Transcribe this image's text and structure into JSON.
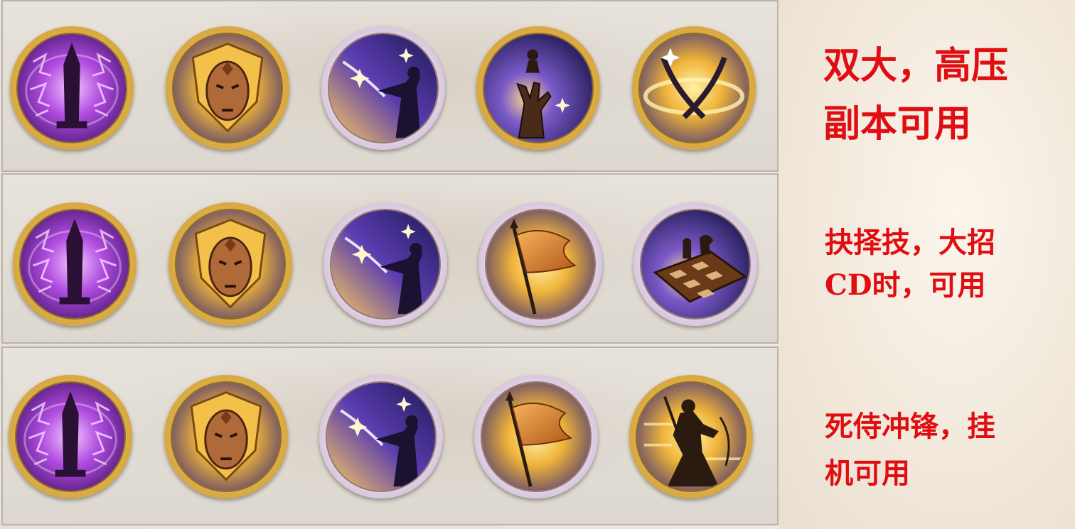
{
  "colors": {
    "note_red": "#e00d12",
    "frame_gold": "#d8a840",
    "frame_silver": "#e9d8ea",
    "panel_bg": "#e2ddd5"
  },
  "rows": [
    {
      "skills": [
        {
          "icon": "purple-obelisk-icon",
          "frame": "gold"
        },
        {
          "icon": "golden-mask-shield-icon",
          "frame": "gold"
        },
        {
          "icon": "sword-silhouette-icon",
          "frame": "silver"
        },
        {
          "icon": "chess-pawn-hand-icon",
          "frame": "gold"
        },
        {
          "icon": "crossed-blades-icon",
          "frame": "gold"
        }
      ],
      "note_lines": [
        "双大，高压",
        "副本可用"
      ]
    },
    {
      "skills": [
        {
          "icon": "purple-obelisk-icon",
          "frame": "gold"
        },
        {
          "icon": "golden-mask-shield-icon",
          "frame": "gold"
        },
        {
          "icon": "sword-silhouette-icon",
          "frame": "silver"
        },
        {
          "icon": "banner-flag-icon",
          "frame": "silver"
        },
        {
          "icon": "chessboard-icon",
          "frame": "silver"
        }
      ],
      "note_lines": [
        "抉择技，大招",
        "CD时，可用"
      ]
    },
    {
      "skills": [
        {
          "icon": "purple-obelisk-icon",
          "frame": "gold"
        },
        {
          "icon": "golden-mask-shield-icon",
          "frame": "gold"
        },
        {
          "icon": "sword-silhouette-icon",
          "frame": "silver"
        },
        {
          "icon": "banner-flag-icon",
          "frame": "silver"
        },
        {
          "icon": "samurai-charge-icon",
          "frame": "gold"
        }
      ],
      "note_lines": [
        "死侍冲锋，挂",
        "机可用"
      ]
    }
  ]
}
